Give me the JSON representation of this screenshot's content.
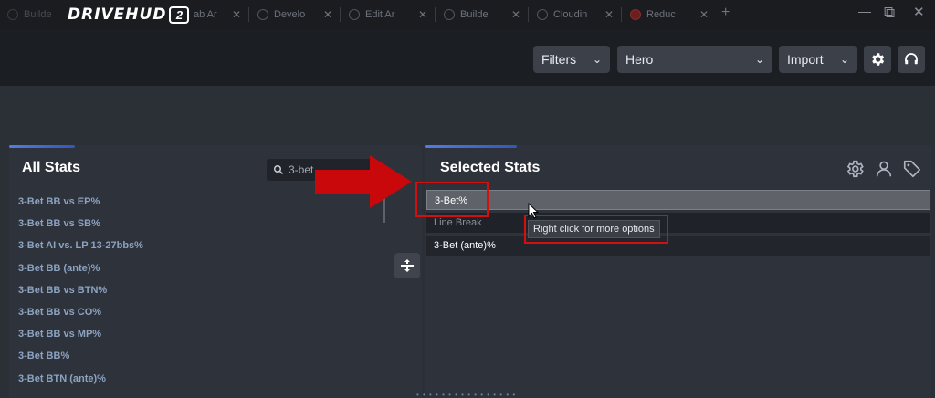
{
  "app": {
    "logo_text": "DRIVEHUD",
    "logo_badge": "2"
  },
  "tabs": [
    {
      "label": "Builde",
      "close": ""
    },
    {
      "label": "ab Ar",
      "close": "✕"
    },
    {
      "label": "Develo",
      "close": "✕"
    },
    {
      "label": "Edit Ar",
      "close": "✕"
    },
    {
      "label": "Builde",
      "close": "✕"
    },
    {
      "label": "Cloudin",
      "close": "✕"
    },
    {
      "label": "Reduc",
      "close": "✕"
    }
  ],
  "newtab_label": "+",
  "window_controls": {
    "minimize": "—",
    "restore": "⧉",
    "close": "✕"
  },
  "toolbar": {
    "filters_label": "Filters",
    "player_value": "Hero",
    "import_label": "Import",
    "settings_icon": "gear-icon",
    "support_icon": "headset-icon"
  },
  "all_stats": {
    "title": "All Stats",
    "search_value": "3-bet",
    "items": [
      "3-Bet BB vs EP%",
      "3-Bet BB vs SB%",
      "3-Bet AI vs. LP 13-27bbs%",
      "3-Bet BB (ante)%",
      "3-Bet BB vs BTN%",
      "3-Bet BB vs CO%",
      "3-Bet BB vs MP%",
      "3-Bet BB%",
      "3-Bet BTN (ante)%"
    ]
  },
  "selected_stats": {
    "title": "Selected Stats",
    "rows": [
      "3-Bet%",
      "Line Break",
      "3-Bet (ante)%"
    ],
    "icons": [
      "gear-icon",
      "user-icon",
      "tag-icon"
    ]
  },
  "tooltip": {
    "text": "Right click for more options"
  },
  "colors": {
    "accent": "#4f7de6",
    "annotation_red": "#d40f10",
    "stat_text": "#8ca3c2",
    "panel_bg": "#2e323a",
    "toolbar_bg": "#1b1e23"
  }
}
